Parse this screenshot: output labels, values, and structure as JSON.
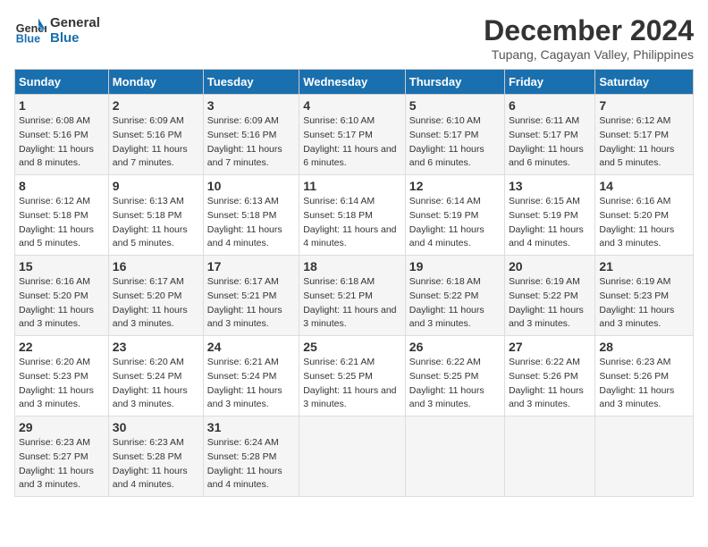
{
  "logo": {
    "line1": "General",
    "line2": "Blue"
  },
  "title": "December 2024",
  "subtitle": "Tupang, Cagayan Valley, Philippines",
  "weekdays": [
    "Sunday",
    "Monday",
    "Tuesday",
    "Wednesday",
    "Thursday",
    "Friday",
    "Saturday"
  ],
  "weeks": [
    [
      {
        "day": "1",
        "sunrise": "Sunrise: 6:08 AM",
        "sunset": "Sunset: 5:16 PM",
        "daylight": "Daylight: 11 hours and 8 minutes."
      },
      {
        "day": "2",
        "sunrise": "Sunrise: 6:09 AM",
        "sunset": "Sunset: 5:16 PM",
        "daylight": "Daylight: 11 hours and 7 minutes."
      },
      {
        "day": "3",
        "sunrise": "Sunrise: 6:09 AM",
        "sunset": "Sunset: 5:16 PM",
        "daylight": "Daylight: 11 hours and 7 minutes."
      },
      {
        "day": "4",
        "sunrise": "Sunrise: 6:10 AM",
        "sunset": "Sunset: 5:17 PM",
        "daylight": "Daylight: 11 hours and 6 minutes."
      },
      {
        "day": "5",
        "sunrise": "Sunrise: 6:10 AM",
        "sunset": "Sunset: 5:17 PM",
        "daylight": "Daylight: 11 hours and 6 minutes."
      },
      {
        "day": "6",
        "sunrise": "Sunrise: 6:11 AM",
        "sunset": "Sunset: 5:17 PM",
        "daylight": "Daylight: 11 hours and 6 minutes."
      },
      {
        "day": "7",
        "sunrise": "Sunrise: 6:12 AM",
        "sunset": "Sunset: 5:17 PM",
        "daylight": "Daylight: 11 hours and 5 minutes."
      }
    ],
    [
      {
        "day": "8",
        "sunrise": "Sunrise: 6:12 AM",
        "sunset": "Sunset: 5:18 PM",
        "daylight": "Daylight: 11 hours and 5 minutes."
      },
      {
        "day": "9",
        "sunrise": "Sunrise: 6:13 AM",
        "sunset": "Sunset: 5:18 PM",
        "daylight": "Daylight: 11 hours and 5 minutes."
      },
      {
        "day": "10",
        "sunrise": "Sunrise: 6:13 AM",
        "sunset": "Sunset: 5:18 PM",
        "daylight": "Daylight: 11 hours and 4 minutes."
      },
      {
        "day": "11",
        "sunrise": "Sunrise: 6:14 AM",
        "sunset": "Sunset: 5:18 PM",
        "daylight": "Daylight: 11 hours and 4 minutes."
      },
      {
        "day": "12",
        "sunrise": "Sunrise: 6:14 AM",
        "sunset": "Sunset: 5:19 PM",
        "daylight": "Daylight: 11 hours and 4 minutes."
      },
      {
        "day": "13",
        "sunrise": "Sunrise: 6:15 AM",
        "sunset": "Sunset: 5:19 PM",
        "daylight": "Daylight: 11 hours and 4 minutes."
      },
      {
        "day": "14",
        "sunrise": "Sunrise: 6:16 AM",
        "sunset": "Sunset: 5:20 PM",
        "daylight": "Daylight: 11 hours and 3 minutes."
      }
    ],
    [
      {
        "day": "15",
        "sunrise": "Sunrise: 6:16 AM",
        "sunset": "Sunset: 5:20 PM",
        "daylight": "Daylight: 11 hours and 3 minutes."
      },
      {
        "day": "16",
        "sunrise": "Sunrise: 6:17 AM",
        "sunset": "Sunset: 5:20 PM",
        "daylight": "Daylight: 11 hours and 3 minutes."
      },
      {
        "day": "17",
        "sunrise": "Sunrise: 6:17 AM",
        "sunset": "Sunset: 5:21 PM",
        "daylight": "Daylight: 11 hours and 3 minutes."
      },
      {
        "day": "18",
        "sunrise": "Sunrise: 6:18 AM",
        "sunset": "Sunset: 5:21 PM",
        "daylight": "Daylight: 11 hours and 3 minutes."
      },
      {
        "day": "19",
        "sunrise": "Sunrise: 6:18 AM",
        "sunset": "Sunset: 5:22 PM",
        "daylight": "Daylight: 11 hours and 3 minutes."
      },
      {
        "day": "20",
        "sunrise": "Sunrise: 6:19 AM",
        "sunset": "Sunset: 5:22 PM",
        "daylight": "Daylight: 11 hours and 3 minutes."
      },
      {
        "day": "21",
        "sunrise": "Sunrise: 6:19 AM",
        "sunset": "Sunset: 5:23 PM",
        "daylight": "Daylight: 11 hours and 3 minutes."
      }
    ],
    [
      {
        "day": "22",
        "sunrise": "Sunrise: 6:20 AM",
        "sunset": "Sunset: 5:23 PM",
        "daylight": "Daylight: 11 hours and 3 minutes."
      },
      {
        "day": "23",
        "sunrise": "Sunrise: 6:20 AM",
        "sunset": "Sunset: 5:24 PM",
        "daylight": "Daylight: 11 hours and 3 minutes."
      },
      {
        "day": "24",
        "sunrise": "Sunrise: 6:21 AM",
        "sunset": "Sunset: 5:24 PM",
        "daylight": "Daylight: 11 hours and 3 minutes."
      },
      {
        "day": "25",
        "sunrise": "Sunrise: 6:21 AM",
        "sunset": "Sunset: 5:25 PM",
        "daylight": "Daylight: 11 hours and 3 minutes."
      },
      {
        "day": "26",
        "sunrise": "Sunrise: 6:22 AM",
        "sunset": "Sunset: 5:25 PM",
        "daylight": "Daylight: 11 hours and 3 minutes."
      },
      {
        "day": "27",
        "sunrise": "Sunrise: 6:22 AM",
        "sunset": "Sunset: 5:26 PM",
        "daylight": "Daylight: 11 hours and 3 minutes."
      },
      {
        "day": "28",
        "sunrise": "Sunrise: 6:23 AM",
        "sunset": "Sunset: 5:26 PM",
        "daylight": "Daylight: 11 hours and 3 minutes."
      }
    ],
    [
      {
        "day": "29",
        "sunrise": "Sunrise: 6:23 AM",
        "sunset": "Sunset: 5:27 PM",
        "daylight": "Daylight: 11 hours and 3 minutes."
      },
      {
        "day": "30",
        "sunrise": "Sunrise: 6:23 AM",
        "sunset": "Sunset: 5:28 PM",
        "daylight": "Daylight: 11 hours and 4 minutes."
      },
      {
        "day": "31",
        "sunrise": "Sunrise: 6:24 AM",
        "sunset": "Sunset: 5:28 PM",
        "daylight": "Daylight: 11 hours and 4 minutes."
      },
      null,
      null,
      null,
      null
    ]
  ]
}
